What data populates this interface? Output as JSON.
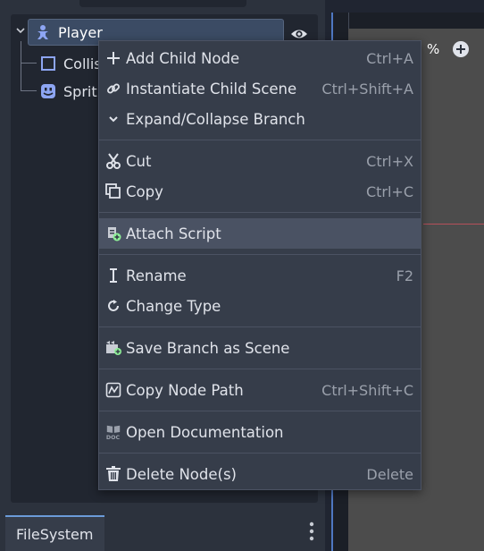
{
  "scene_tree": {
    "nodes": [
      {
        "name": "Player",
        "icon": "character-body-icon"
      },
      {
        "name": "Collis",
        "icon": "collision-shape-icon"
      },
      {
        "name": "Sprit",
        "icon": "sprite-icon"
      }
    ]
  },
  "context_menu": {
    "items": [
      {
        "label": "Add Child Node",
        "shortcut": "Ctrl+A",
        "icon": "plus-icon"
      },
      {
        "label": "Instantiate Child Scene",
        "shortcut": "Ctrl+Shift+A",
        "icon": "link-icon"
      },
      {
        "label": "Expand/Collapse Branch",
        "shortcut": "",
        "icon": "chevron-down-icon"
      },
      {
        "label": "Cut",
        "shortcut": "Ctrl+X",
        "icon": "scissors-icon"
      },
      {
        "label": "Copy",
        "shortcut": "Ctrl+C",
        "icon": "copy-icon"
      },
      {
        "label": "Attach Script",
        "shortcut": "",
        "icon": "attach-script-icon",
        "highlighted": true
      },
      {
        "label": "Rename",
        "shortcut": "F2",
        "icon": "text-cursor-icon"
      },
      {
        "label": "Change Type",
        "shortcut": "",
        "icon": "refresh-icon"
      },
      {
        "label": "Save Branch as Scene",
        "shortcut": "",
        "icon": "save-scene-icon"
      },
      {
        "label": "Copy Node Path",
        "shortcut": "Ctrl+Shift+C",
        "icon": "node-path-icon"
      },
      {
        "label": "Open Documentation",
        "shortcut": "",
        "icon": "documentation-icon"
      },
      {
        "label": "Delete Node(s)",
        "shortcut": "Delete",
        "icon": "trash-icon"
      }
    ]
  },
  "filesystem": {
    "tab_label": "FileSystem"
  },
  "viewport": {
    "zoom_suffix": "%"
  },
  "colors": {
    "accent": "#6b9bd8",
    "menu_bg": "#363d4a",
    "menu_hover": "#4a5263",
    "selection": "#3b4b64",
    "node_icon_blue": "#8da5f3",
    "add_green": "#8eef97"
  }
}
